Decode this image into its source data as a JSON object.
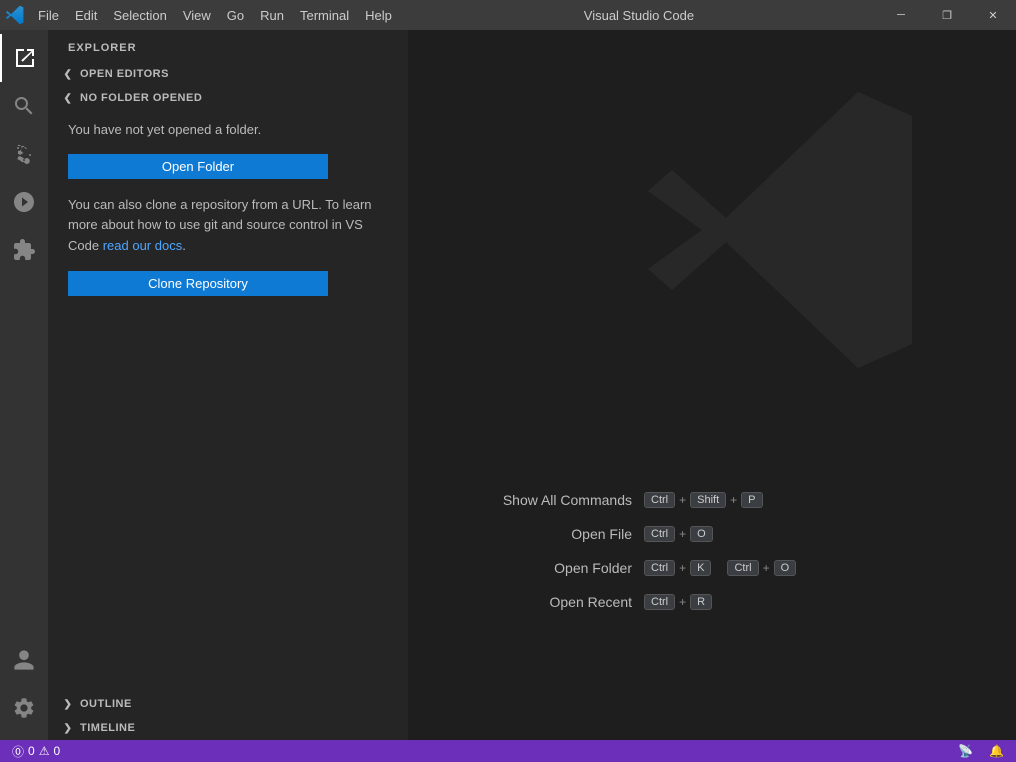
{
  "titleBar": {
    "logo": "VS",
    "menu": [
      "File",
      "Edit",
      "Selection",
      "View",
      "Go",
      "Run",
      "Terminal",
      "Help"
    ],
    "title": "Visual Studio Code",
    "controls": [
      "minimize",
      "maximize",
      "close"
    ]
  },
  "activityBar": {
    "icons": [
      {
        "name": "explorer-icon",
        "label": "Explorer",
        "active": true
      },
      {
        "name": "search-icon",
        "label": "Search",
        "active": false
      },
      {
        "name": "source-control-icon",
        "label": "Source Control",
        "active": false
      },
      {
        "name": "run-icon",
        "label": "Run and Debug",
        "active": false
      },
      {
        "name": "extensions-icon",
        "label": "Extensions",
        "active": false
      }
    ],
    "bottomIcons": [
      {
        "name": "accounts-icon",
        "label": "Accounts"
      },
      {
        "name": "settings-icon",
        "label": "Settings"
      }
    ]
  },
  "sidebar": {
    "header": "Explorer",
    "sections": [
      {
        "label": "OPEN EDITORS",
        "collapsed": false
      },
      {
        "label": "NO FOLDER OPENED",
        "collapsed": false
      }
    ],
    "noFolderText": "You have not yet opened a folder.",
    "openFolderButton": "Open Folder",
    "cloneText1": "You can also clone a repository from a URL. To learn more about how to use git and source control in VS Code ",
    "cloneLink": "read our docs",
    "clonePeriod": ".",
    "cloneRepositoryButton": "Clone Repository",
    "outline": "OUTLINE",
    "timeline": "TIMELINE"
  },
  "shortcuts": [
    {
      "label": "Show All Commands",
      "keys": [
        "Ctrl",
        "+",
        "Shift",
        "+",
        "P"
      ]
    },
    {
      "label": "Open File",
      "keys": [
        "Ctrl",
        "+",
        "O"
      ]
    },
    {
      "label": "Open Folder",
      "keys": [
        "Ctrl",
        "+",
        "K",
        "Ctrl",
        "+",
        "O"
      ]
    },
    {
      "label": "Open Recent",
      "keys": [
        "Ctrl",
        "+",
        "R"
      ]
    }
  ],
  "statusBar": {
    "left": [
      {
        "text": "⓪",
        "name": "git-icon"
      },
      {
        "text": "0",
        "name": "error-count"
      },
      {
        "text": "△",
        "name": "warning-icon"
      },
      {
        "text": "0",
        "name": "warning-count"
      }
    ],
    "right": [
      {
        "text": "🔔",
        "name": "notifications-icon"
      },
      {
        "text": "📻",
        "name": "remote-icon"
      }
    ]
  }
}
